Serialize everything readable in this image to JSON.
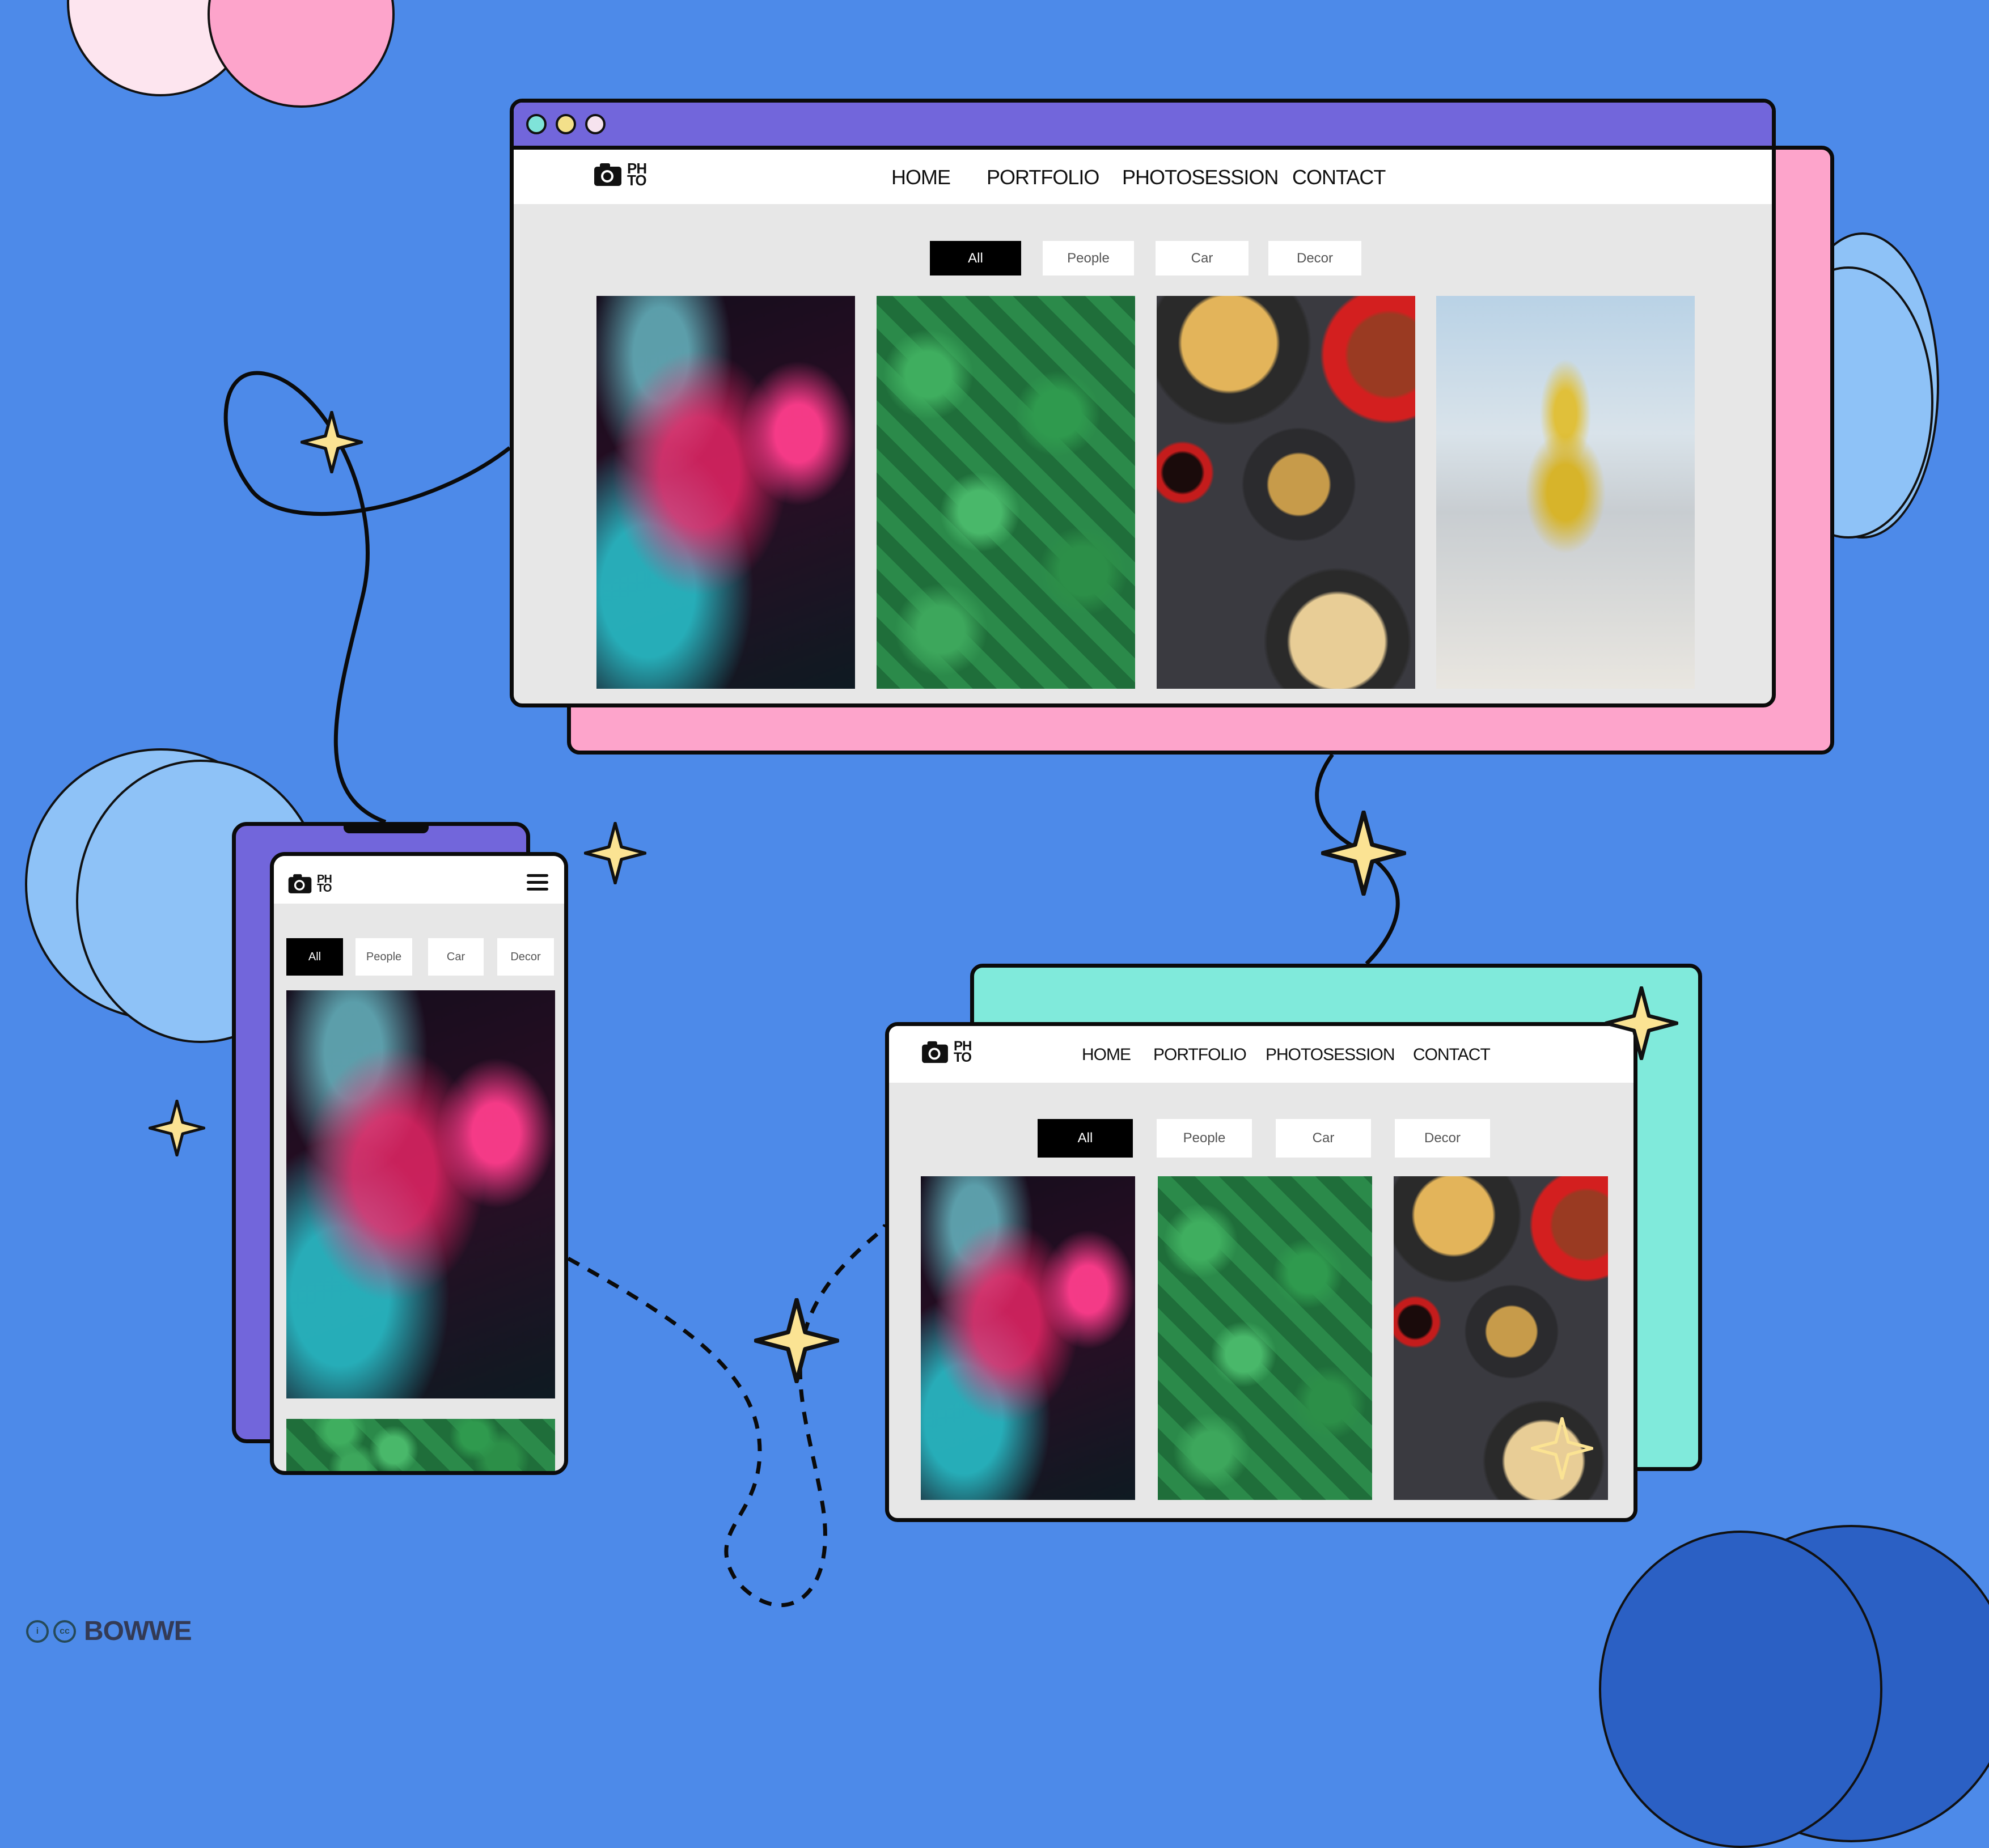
{
  "site": {
    "logo_top": "PH",
    "logo_bottom": "TO",
    "nav": [
      "HOME",
      "PORTFOLIO",
      "PHOTOSESSION",
      "CONTACT"
    ],
    "filters": [
      "All",
      "People",
      "Car",
      "Decor"
    ],
    "active_filter": "All"
  },
  "desktop_window": {
    "traffic_lights": [
      "#7fe3d9",
      "#f3e08a",
      "#f6e3ee"
    ],
    "photos": [
      "neon-portrait",
      "green-leaves",
      "asian-food",
      "yellow-tracksuit"
    ]
  },
  "tablet_window": {
    "photos": [
      "neon-portrait",
      "green-leaves",
      "asian-food"
    ]
  },
  "mobile_window": {
    "photos": [
      "neon-portrait",
      "green-leaves"
    ]
  },
  "footer": {
    "license_icons": [
      "attribution-icon",
      "cc-icon"
    ],
    "brand": "BOWWE"
  },
  "colors": {
    "background": "#4d8ae9",
    "window_titlebar": "#7266db",
    "pink_panel": "#fda4cb",
    "teal_panel": "#80eadb",
    "sparkle": "#fbe393"
  }
}
